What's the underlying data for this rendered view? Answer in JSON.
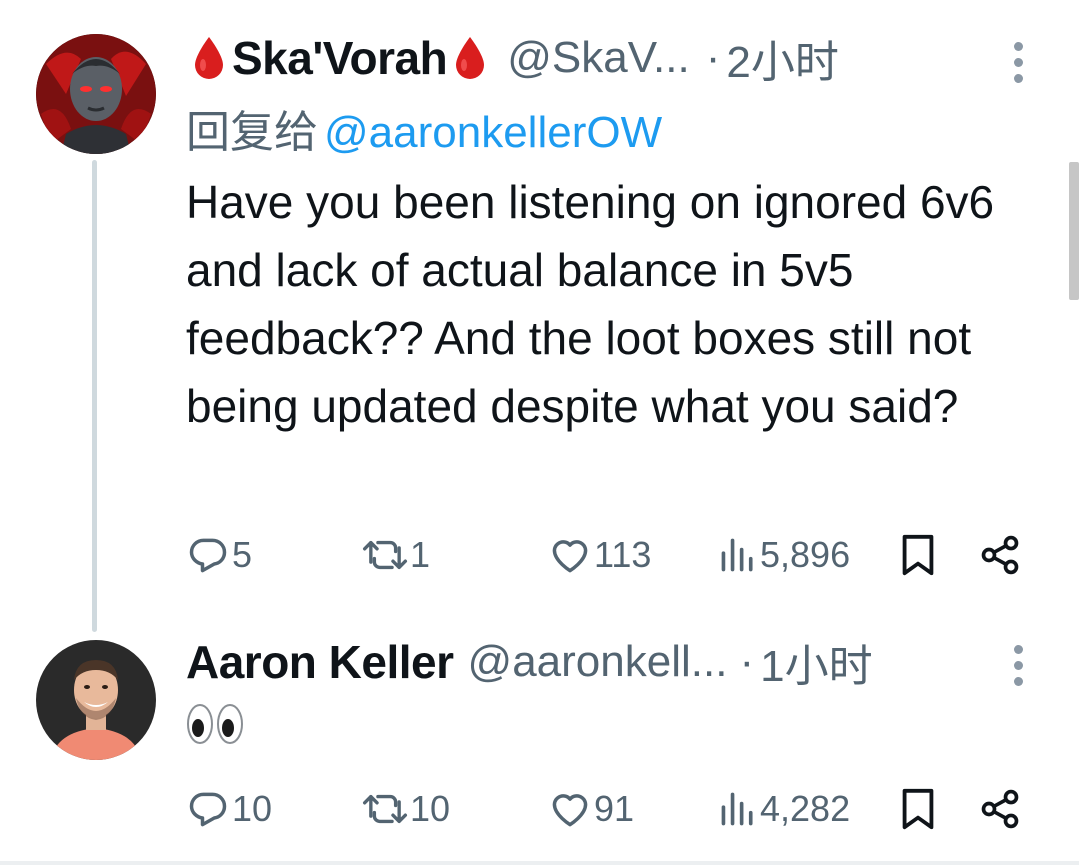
{
  "tweet1": {
    "display_name": "Ska'Vorah",
    "handle": "@SkaV...",
    "separator": "·",
    "time": "2小时",
    "reply_prefix": "回复给",
    "reply_mention": "@aaronkellerOW",
    "text": "Have you been listening on ignored 6v6 and lack of actual balance in 5v5 feedback?? And the loot boxes still not being updated despite what you said?",
    "replies": "5",
    "reposts": "1",
    "likes": "113",
    "views": "5,896"
  },
  "tweet2": {
    "display_name": "Aaron Keller",
    "handle": "@aaronkell...",
    "separator": "·",
    "time": "1小时",
    "text": "👀",
    "replies": "10",
    "reposts": "10",
    "likes": "91",
    "views": "4,282"
  },
  "icons": {
    "name_decoration": "blood-drop-icon",
    "reply": "reply-icon",
    "repost": "repost-icon",
    "like": "heart-icon",
    "views": "views-icon",
    "bookmark": "bookmark-icon",
    "share": "share-icon",
    "more": "more-vertical-icon"
  },
  "colors": {
    "link": "#1d9bf0",
    "muted": "#536471",
    "text": "#0f1419",
    "drop": "#d91e1e"
  }
}
